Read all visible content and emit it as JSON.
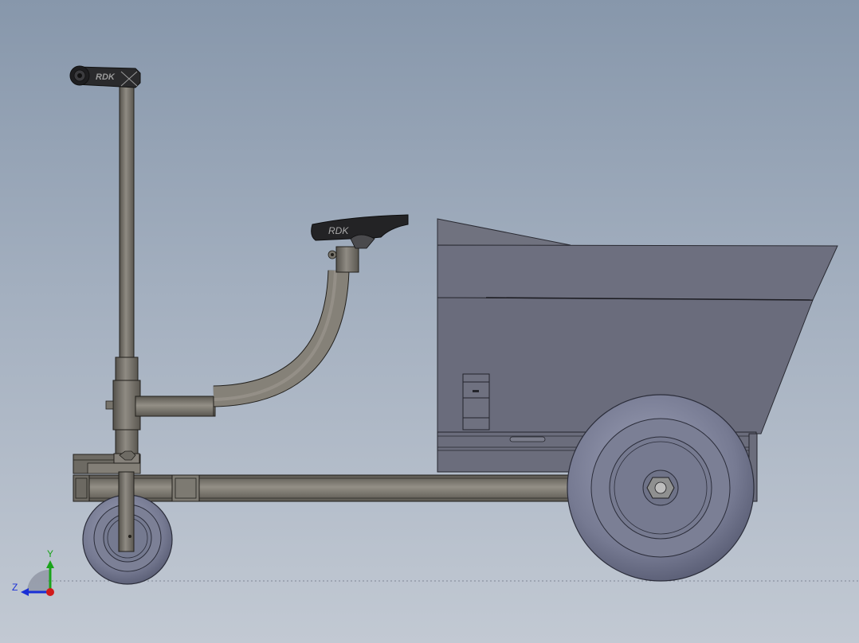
{
  "viewport": {
    "background_top": "#8797ab",
    "background_bottom": "#c2c9d3"
  },
  "model": {
    "seat_logo": "RDK",
    "stem_logo": "RDK"
  },
  "triad": {
    "y_label": "Y",
    "z_label": "Z",
    "y_color": "#1aa31a",
    "z_color": "#1a2fd6",
    "x_color": "#d11a1a"
  }
}
